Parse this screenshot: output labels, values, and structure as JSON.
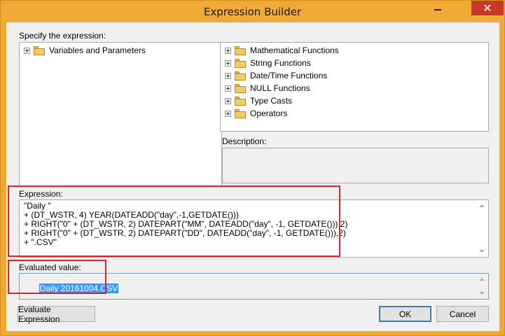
{
  "window": {
    "title": "Expression Builder",
    "close_glyph": "✕",
    "minimize_icon": "minimize-icon"
  },
  "specify_label": "Specify the expression:",
  "left_tree": [
    {
      "label": "Variables and Parameters",
      "icon": "folder-icon"
    }
  ],
  "right_tree": [
    {
      "label": "Mathematical Functions",
      "icon": "folder-icon"
    },
    {
      "label": "String Functions",
      "icon": "folder-icon"
    },
    {
      "label": "Date/Time Functions",
      "icon": "folder-icon"
    },
    {
      "label": "NULL Functions",
      "icon": "folder-icon"
    },
    {
      "label": "Type Casts",
      "icon": "folder-icon"
    },
    {
      "label": "Operators",
      "icon": "folder-icon"
    }
  ],
  "description_label": "Description:",
  "expression": {
    "label": "Expression:",
    "lines": [
      "\"Daily \"",
      "+ (DT_WSTR, 4) YEAR(DATEADD(\"day\",-1,GETDATE()))",
      "+ RIGHT(\"0\" + (DT_WSTR, 2) DATEPART(\"MM\", DATEADD(\"day\", -1, GETDATE())),2)",
      "+ RIGHT(\"0\" + (DT_WSTR, 2) DATEPART(\"DD\", DATEADD(\"day\", -1, GETDATE())),2)",
      "+ \".CSV\""
    ]
  },
  "evaluated": {
    "label": "Evaluated value:",
    "value": "Daily 20161004.CSV"
  },
  "buttons": {
    "evaluate": "Evaluate Expression",
    "ok": "OK",
    "cancel": "Cancel"
  },
  "colors": {
    "title_bar": "#f1aa35",
    "close_button": "#c7392b",
    "highlight_rect": "#e3212d",
    "selection": "#3399ff"
  }
}
